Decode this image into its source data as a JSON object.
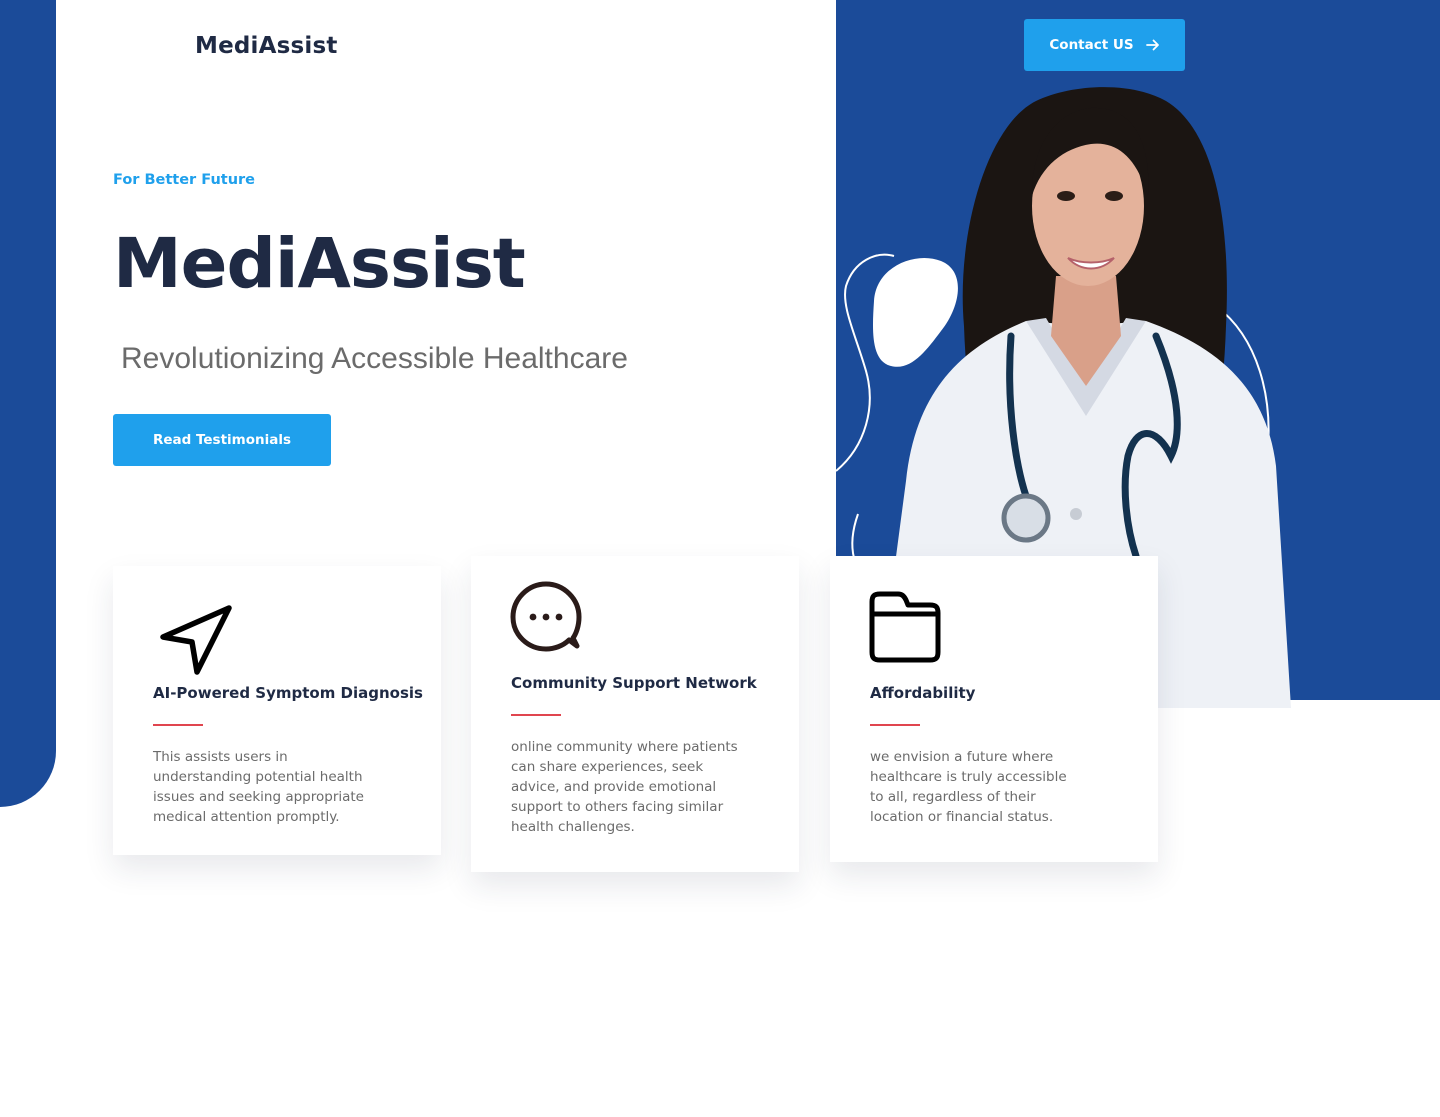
{
  "header": {
    "logo": "MediAssist",
    "contact_label": "Contact US"
  },
  "hero": {
    "kicker": "For Better Future",
    "title": "MediAssist",
    "subtitle": "Revolutionizing Accessible Healthcare",
    "cta_label": "Read Testimonials"
  },
  "features": [
    {
      "icon": "navigation-arrow-icon",
      "title": "AI-Powered Symptom Diagnosis",
      "lines": [
        "This assists users in",
        "understanding potential health",
        "issues and seeking appropriate",
        "medical attention promptly."
      ]
    },
    {
      "icon": "chat-bubble-icon",
      "title": "Community Support Network",
      "lines": [
        "online community where patients",
        "can share experiences, seek",
        "advice, and provide emotional",
        "support to others facing similar",
        "health challenges."
      ]
    },
    {
      "icon": "folder-icon",
      "title": "Affordability",
      "lines": [
        "we envision a future where",
        "healthcare is truly accessible",
        "to all, regardless of their",
        "location or financial status."
      ]
    }
  ],
  "colors": {
    "brand_blue": "#1b4b99",
    "accent_blue": "#1fa0ec",
    "heading": "#1f2a44",
    "divider_red": "#e0454f"
  }
}
